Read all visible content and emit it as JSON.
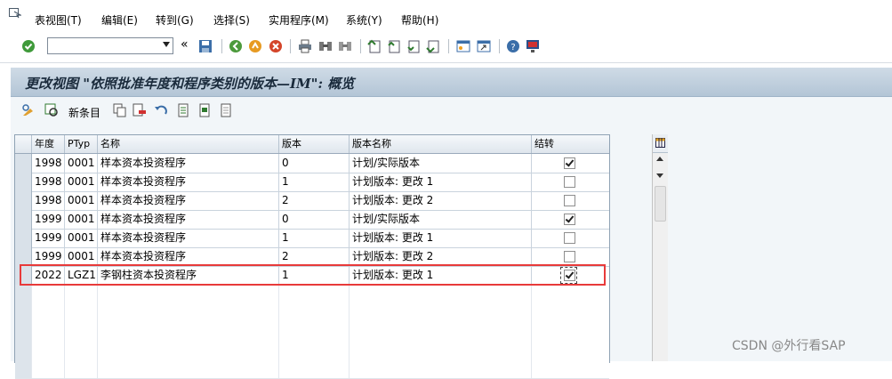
{
  "menu": {
    "items": [
      "表视图(T)",
      "编辑(E)",
      "转到(G)",
      "选择(S)",
      "实用程序(M)",
      "系统(Y)",
      "帮助(H)"
    ]
  },
  "toolbar": {
    "command_value": "",
    "back_chevrons": "«"
  },
  "title": "更改视图 \"依照批准年度和程序类别的版本—IM\": 概览",
  "app_toolbar": {
    "new_entries_label": "新条目"
  },
  "table": {
    "columns": [
      "年度",
      "PTyp",
      "名称",
      "版本",
      "版本名称",
      "结转"
    ],
    "rows": [
      {
        "year": "1998",
        "ptyp": "0001",
        "name": "样本资本投资程序",
        "version": "0",
        "version_name": "计划/实际版本",
        "carry": true
      },
      {
        "year": "1998",
        "ptyp": "0001",
        "name": "样本资本投资程序",
        "version": "1",
        "version_name": "计划版本: 更改 1",
        "carry": false
      },
      {
        "year": "1998",
        "ptyp": "0001",
        "name": "样本资本投资程序",
        "version": "2",
        "version_name": "计划版本: 更改 2",
        "carry": false
      },
      {
        "year": "1999",
        "ptyp": "0001",
        "name": "样本资本投资程序",
        "version": "0",
        "version_name": "计划/实际版本",
        "carry": true
      },
      {
        "year": "1999",
        "ptyp": "0001",
        "name": "样本资本投资程序",
        "version": "1",
        "version_name": "计划版本: 更改 1",
        "carry": false
      },
      {
        "year": "1999",
        "ptyp": "0001",
        "name": "样本资本投资程序",
        "version": "2",
        "version_name": "计划版本: 更改 2",
        "carry": false
      },
      {
        "year": "2022",
        "ptyp": "LGZ1",
        "name": "李钢柱资本投资程序",
        "version": "1",
        "version_name": "计划版本: 更改 1",
        "carry": true
      }
    ]
  },
  "watermark": "CSDN @外行看SAP",
  "colors": {
    "highlight": "#e83a3a",
    "title_band": "#c2d2e1"
  }
}
